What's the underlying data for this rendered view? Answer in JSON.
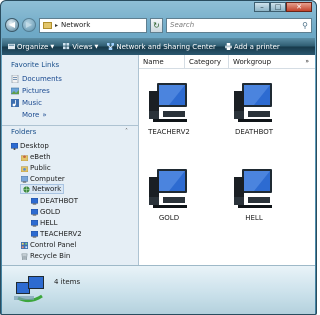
{
  "window": {
    "caption_buttons": [
      "minimize-icon",
      "maximize-icon",
      "close-icon"
    ]
  },
  "address_bar": {
    "path_label": "Network",
    "search_placeholder": "Search"
  },
  "toolbar": {
    "items": [
      {
        "label": "Organize",
        "icon": "organize-icon",
        "has_dropdown": true
      },
      {
        "label": "Views",
        "icon": "views-icon",
        "has_dropdown": true
      },
      {
        "label": "Network and Sharing Center",
        "icon": "network-sharing-icon",
        "has_dropdown": false
      },
      {
        "label": "Add a printer",
        "icon": "printer-icon",
        "has_dropdown": false
      }
    ]
  },
  "nav": {
    "favorite_links_title": "Favorite Links",
    "favorites": [
      {
        "label": "Documents",
        "icon": "documents-icon"
      },
      {
        "label": "Pictures",
        "icon": "pictures-icon"
      },
      {
        "label": "Music",
        "icon": "music-icon"
      }
    ],
    "more_label": "More",
    "folders_title": "Folders",
    "tree": [
      {
        "label": "Desktop",
        "icon": "desktop-icon",
        "indent": 0
      },
      {
        "label": "eBeth",
        "icon": "user-folder-icon",
        "indent": 1
      },
      {
        "label": "Public",
        "icon": "public-folder-icon",
        "indent": 1
      },
      {
        "label": "Computer",
        "icon": "computer-icon",
        "indent": 1
      },
      {
        "label": "Network",
        "icon": "network-icon",
        "indent": 1,
        "selected": true
      },
      {
        "label": "DEATHBOT",
        "icon": "computer-icon",
        "indent": 2
      },
      {
        "label": "GOLD",
        "icon": "computer-icon",
        "indent": 2
      },
      {
        "label": "HELL",
        "icon": "computer-icon",
        "indent": 2
      },
      {
        "label": "TEACHERV2",
        "icon": "computer-icon",
        "indent": 2
      },
      {
        "label": "Control Panel",
        "icon": "control-panel-icon",
        "indent": 1
      },
      {
        "label": "Recycle Bin",
        "icon": "recycle-bin-icon",
        "indent": 1
      }
    ]
  },
  "columns": [
    "Name",
    "Category",
    "Workgroup"
  ],
  "files": [
    {
      "label": "TEACHERV2",
      "icon": "network-computer-icon"
    },
    {
      "label": "DEATHBOT",
      "icon": "network-computer-icon"
    },
    {
      "label": "GOLD",
      "icon": "network-computer-icon"
    },
    {
      "label": "HELL",
      "icon": "network-computer-icon"
    }
  ],
  "status": {
    "count": "4 items"
  },
  "colors": {
    "toolbar_dark": "#17394a",
    "nav_bg": "#e5eef5",
    "link_blue": "#1b4a90",
    "screen_blue": "#2d6bd1"
  }
}
